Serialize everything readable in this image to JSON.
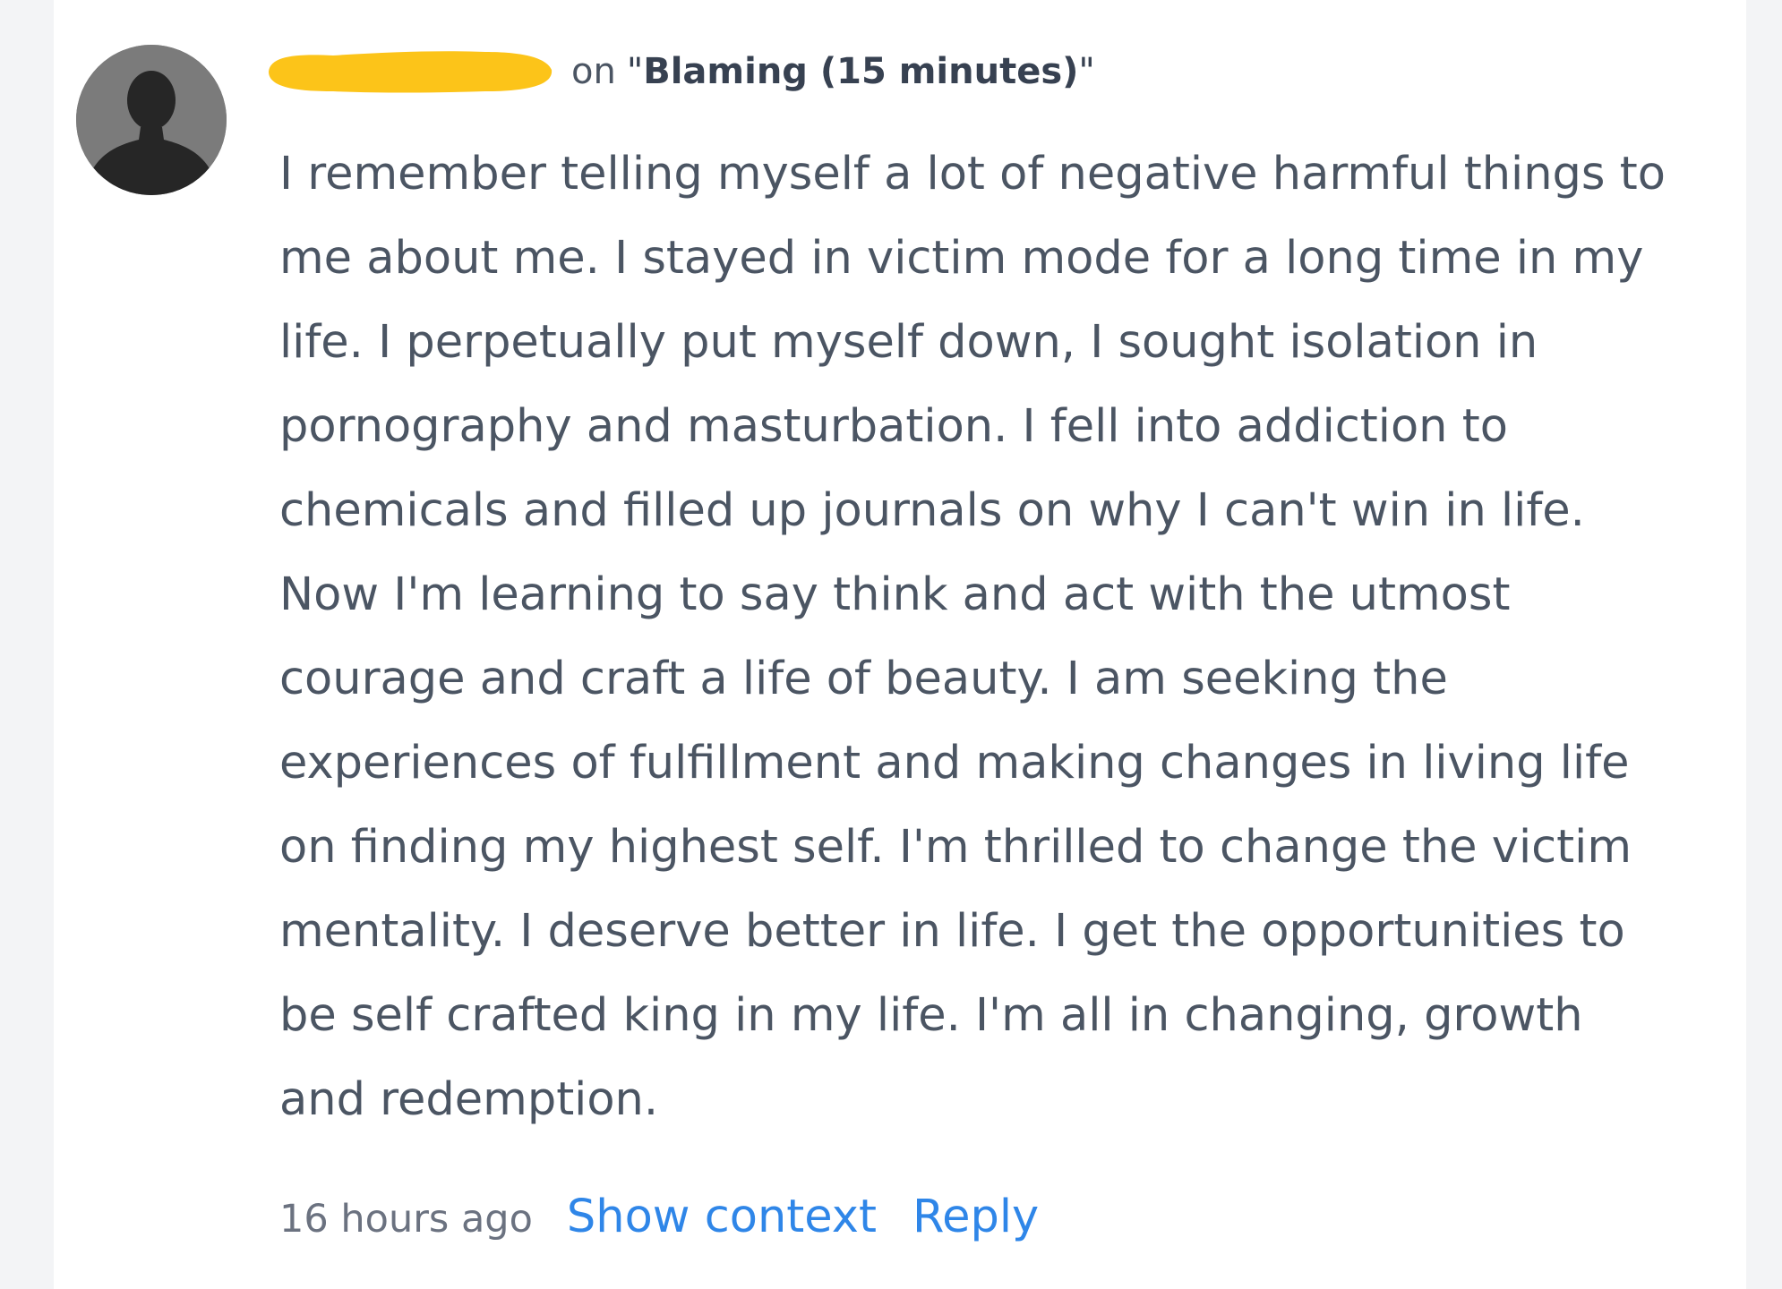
{
  "comment": {
    "author_redacted": true,
    "redaction_color": "#fcc419",
    "on_label": "on",
    "topic_title": "Blaming (15 minutes)",
    "body": "I remember telling myself a lot of negative harmful things to me about me. I stayed in victim mode for a long time in my life. I perpetually put myself down, I sought isolation in pornography and masturbation. I fell into addiction to chemicals and filled up journals on why I can't win in life. Now I'm learning to say think and act with the utmost courage and craft a life of beauty. I am seeking the experiences of fulfillment and making changes in living life on finding my highest self. I'm thrilled to change the victim mentality. I deserve better in life. I get the opportunities to be self crafted king in my life. I'm all in changing, growth and redemption.",
    "timestamp": "16 hours ago",
    "show_context_label": "Show context",
    "reply_label": "Reply"
  },
  "colors": {
    "link": "#2f86e8",
    "text": "#4b5563",
    "meta": "#6b7280",
    "avatar_bg": "#7b7b7b",
    "avatar_silhouette": "#262626"
  },
  "icons": {
    "avatar": "default-user-silhouette-icon"
  }
}
